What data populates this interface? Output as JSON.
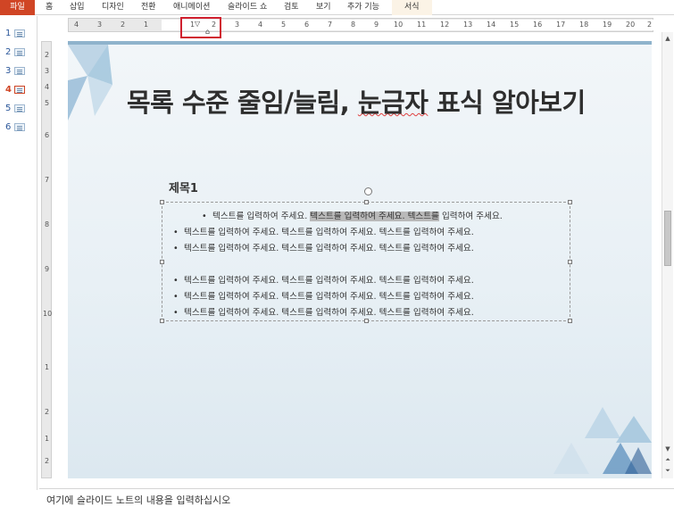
{
  "ribbon": {
    "file_tab": "파일",
    "tabs": [
      "홈",
      "삽입",
      "디자인",
      "전환",
      "애니메이션",
      "슬라이드 쇼",
      "검토",
      "보기",
      "추가 기능",
      "서식"
    ]
  },
  "thumbnails": [
    {
      "num": "1"
    },
    {
      "num": "2"
    },
    {
      "num": "3"
    },
    {
      "num": "4",
      "active": true
    },
    {
      "num": "5"
    },
    {
      "num": "6"
    }
  ],
  "ruler": {
    "h_ticks": [
      "4",
      "3",
      "2",
      "1",
      "1",
      "2",
      "3",
      "4",
      "5",
      "6",
      "7",
      "8",
      "9",
      "10",
      "11",
      "12",
      "13",
      "14",
      "15",
      "16",
      "17",
      "18",
      "19",
      "20",
      "2"
    ],
    "v_ticks": [
      "2",
      "3",
      "4",
      "5",
      "6",
      "7",
      "8",
      "9",
      "10",
      "1",
      "2",
      "1",
      "2"
    ]
  },
  "slide": {
    "title": "목록 수준 줄임/늘림, 눈금자 표식 알아보기",
    "title_squiggle": "눈금자",
    "subheading": "제목1",
    "bullets": {
      "line1_pre": "텍스트를 입력하여 주세요. ",
      "line1_sel": "텍스트를 입력하여 주세요. 텍스트를",
      "line1_post": " 입력하여 주세요.",
      "line": "텍스트를 입력하여 주세요. 텍스트를 입력하여 주세요. 텍스트를 입력하여 주세요."
    },
    "bullet_char": "•"
  },
  "notes": {
    "placeholder": "여기에 슬라이드 노트의 내용을 입력하십시오"
  },
  "colors": {
    "accent": "#d04525",
    "highlight_box": "#d0202f"
  }
}
